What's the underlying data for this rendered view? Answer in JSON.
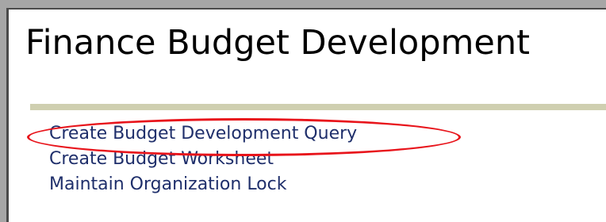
{
  "page": {
    "title": "Finance Budget Development"
  },
  "links": [
    {
      "label": "Create Budget Development Query",
      "highlighted": true
    },
    {
      "label": "Create Budget Worksheet",
      "highlighted": false
    },
    {
      "label": "Maintain Organization Lock",
      "highlighted": false
    }
  ],
  "colors": {
    "link": "#1f2f6b",
    "rule": "#cfcfb0",
    "highlight": "#e8141b",
    "border": "#a6a6a6"
  }
}
